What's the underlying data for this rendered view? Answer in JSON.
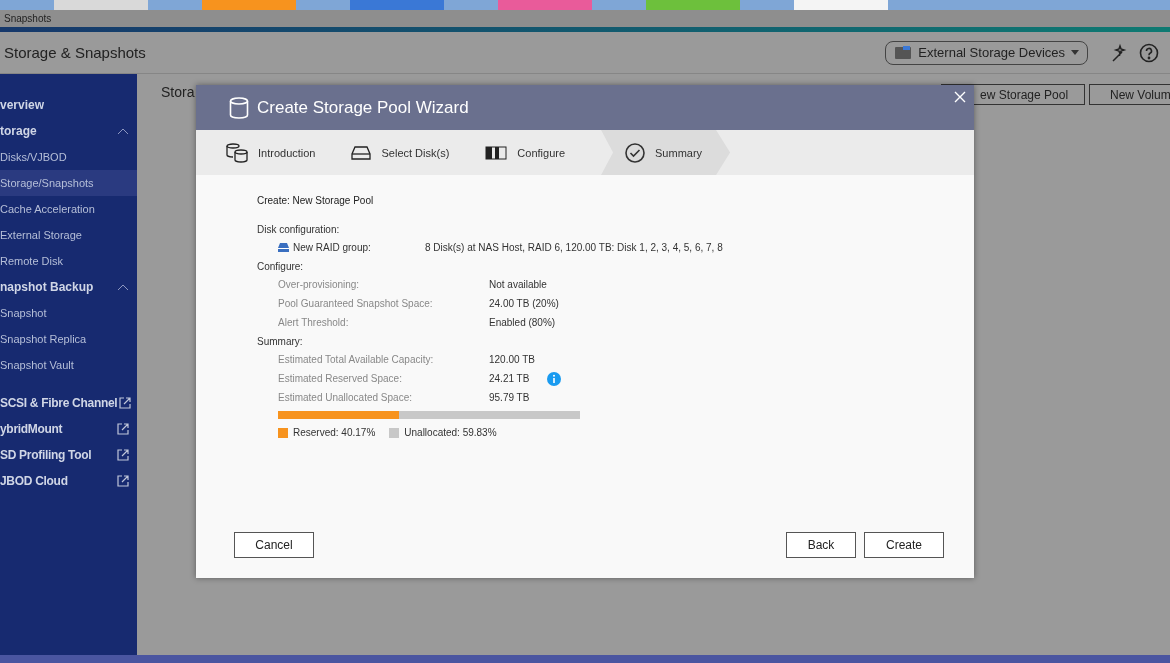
{
  "window": {
    "title": "Snapshots"
  },
  "header": {
    "title": "Storage & Snapshots",
    "device_menu": "External Storage Devices"
  },
  "sidebar": {
    "items": [
      {
        "label": "verview",
        "kind": "item",
        "selected": false
      },
      {
        "label": "torage",
        "kind": "group",
        "expanded": true,
        "selected": false
      },
      {
        "label": "Disks/VJBOD",
        "kind": "sub",
        "selected": false
      },
      {
        "label": "Storage/Snapshots",
        "kind": "sub",
        "selected": true
      },
      {
        "label": "Cache Acceleration",
        "kind": "sub",
        "selected": false
      },
      {
        "label": "External Storage",
        "kind": "sub",
        "selected": false
      },
      {
        "label": "Remote Disk",
        "kind": "sub",
        "selected": false
      },
      {
        "label": "napshot Backup",
        "kind": "group",
        "expanded": true,
        "selected": false
      },
      {
        "label": "Snapshot",
        "kind": "sub",
        "selected": false
      },
      {
        "label": "Snapshot Replica",
        "kind": "sub",
        "selected": false
      },
      {
        "label": "Snapshot Vault",
        "kind": "sub",
        "selected": false
      },
      {
        "label": "SCSI & Fibre Channel",
        "kind": "link",
        "selected": false
      },
      {
        "label": "ybridMount",
        "kind": "link",
        "selected": false
      },
      {
        "label": "SD Profiling Tool",
        "kind": "link",
        "selected": false
      },
      {
        "label": "JBOD Cloud",
        "kind": "link",
        "selected": false
      }
    ]
  },
  "content": {
    "title": "Stora",
    "buttons": [
      "ew Storage Pool",
      "New Volum"
    ]
  },
  "wizard": {
    "title": "Create Storage Pool Wizard",
    "steps": [
      {
        "label": "Introduction",
        "kind": "intro",
        "selected": false
      },
      {
        "label": "Select Disk(s)",
        "kind": "disk",
        "selected": false
      },
      {
        "label": "Configure",
        "kind": "configure",
        "selected": false
      },
      {
        "label": "Summary",
        "kind": "summary",
        "selected": true
      }
    ],
    "create_line": "Create: New Storage Pool",
    "sections": [
      {
        "heading": "Disk configuration:",
        "rows": [
          {
            "label": "New RAID group:",
            "value": "8 Disk(s) at NAS Host, RAID 6, 120.00 TB: Disk 1, 2, 3, 4, 5, 6, 7, 8",
            "kind": "disk"
          }
        ]
      },
      {
        "heading": "Configure:",
        "rows": [
          {
            "label": "Over-provisioning:",
            "value": "Not available",
            "kind": "plain"
          },
          {
            "label": "Pool Guaranteed Snapshot Space:",
            "value": "24.00 TB (20%)",
            "kind": "plain"
          },
          {
            "label": "Alert Threshold:",
            "value": "Enabled (80%)",
            "kind": "plain"
          }
        ]
      },
      {
        "heading": "Summary:",
        "rows": [
          {
            "label": "Estimated Total Available Capacity:",
            "value": "120.00 TB",
            "kind": "plain"
          },
          {
            "label": "Estimated Reserved Space:",
            "value": "24.21 TB",
            "kind": "info"
          },
          {
            "label": "Estimated Unallocated Space:",
            "value": "95.79 TB",
            "kind": "plain"
          }
        ]
      }
    ],
    "usage": {
      "level": 0.4017,
      "legend": [
        {
          "label": "Reserved: 40.17%",
          "color": "#f7931e"
        },
        {
          "label": "Unallocated: 59.83%",
          "color": "#c8c8c8"
        }
      ]
    },
    "buttons": {
      "cancel": "Cancel",
      "back": "Back",
      "create": "Create"
    }
  }
}
